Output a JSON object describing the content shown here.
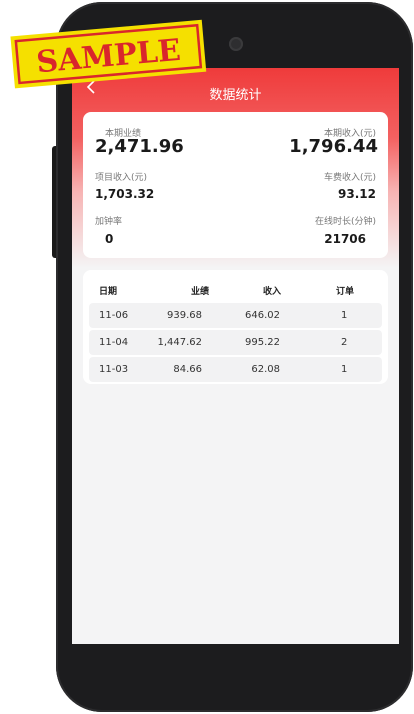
{
  "watermark": "SAMPLE",
  "nav": {
    "back_icon": "chevron-left-icon",
    "title": "数据统计"
  },
  "stats": {
    "current_performance": {
      "label": "本期业绩",
      "value": "2,471.96"
    },
    "current_income": {
      "label": "本期收入(元)",
      "value": "1,796.44"
    },
    "project_income": {
      "label": "项目收入(元)",
      "value": "1,703.32"
    },
    "fare_income": {
      "label": "车费收入(元)",
      "value": "93.12"
    },
    "overtime_rate": {
      "label": "加钟率",
      "value": "0"
    },
    "online_duration": {
      "label": "在线时长(分钟)",
      "value": "21706"
    }
  },
  "table": {
    "headers": [
      "日期",
      "业绩",
      "收入",
      "订单"
    ],
    "rows": [
      {
        "date": "11-06",
        "performance": "939.68",
        "income": "646.02",
        "orders": "1"
      },
      {
        "date": "11-04",
        "performance": "1,447.62",
        "income": "995.22",
        "orders": "2"
      },
      {
        "date": "11-03",
        "performance": "84.66",
        "income": "62.08",
        "orders": "1"
      }
    ]
  },
  "colors": {
    "brand_red": "#ef3b3b",
    "watermark_red": "#d9262c",
    "watermark_yellow": "#f5e000"
  }
}
